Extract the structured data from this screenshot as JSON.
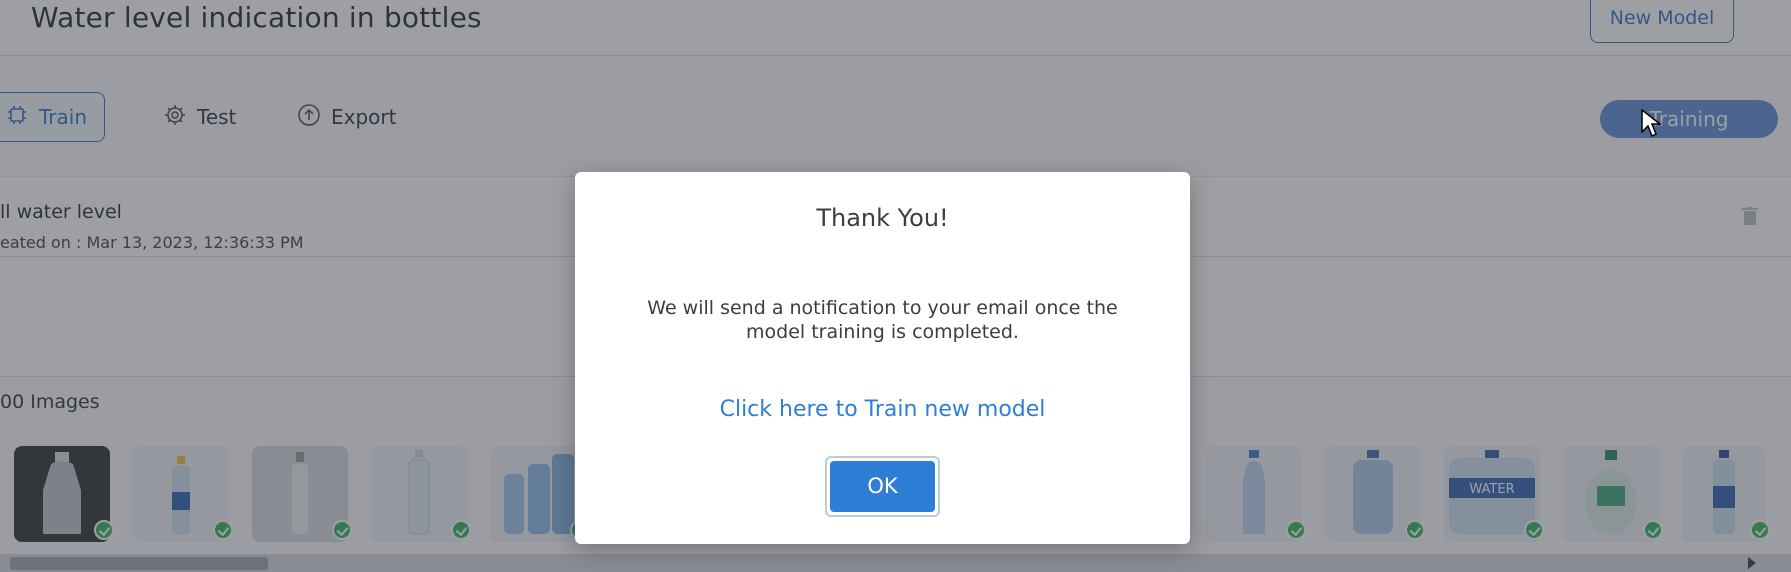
{
  "header": {
    "title": "Water level indication in bottles",
    "new_model_label": "New Model"
  },
  "tabs": [
    {
      "label": "Train",
      "icon": "chip-icon"
    },
    {
      "label": "Test",
      "icon": "gear-icon"
    },
    {
      "label": "Export",
      "icon": "upload-icon"
    }
  ],
  "training_button_label": "Training",
  "model": {
    "name": "ll water level",
    "created": "eated on : Mar 13, 2023, 12:36:33 PM"
  },
  "images": {
    "count_label": "00 Images"
  },
  "modal": {
    "title": "Thank You!",
    "message": "We will send a notification to your email once the model training is completed.",
    "link_label": "Click here to Train new model",
    "ok_label": "OK"
  },
  "colors": {
    "accent": "#2f7ed6",
    "success": "#2fb35a"
  }
}
